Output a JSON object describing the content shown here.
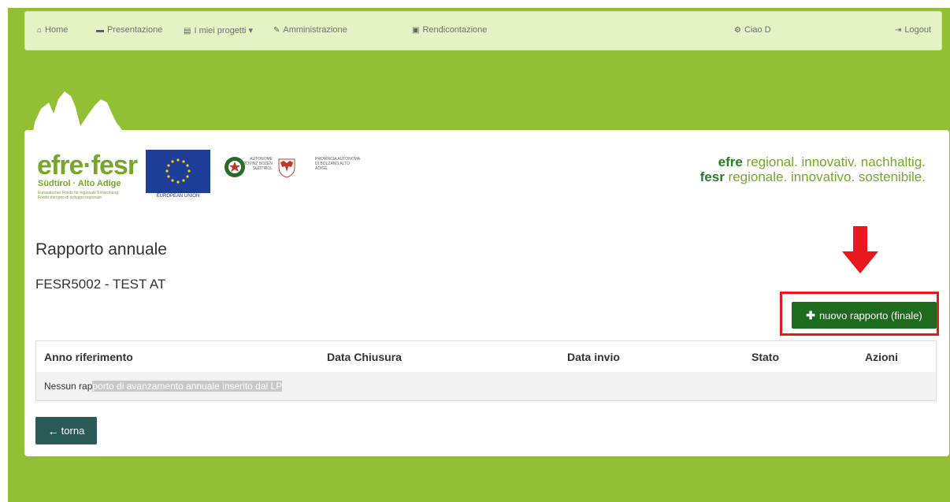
{
  "nav": {
    "home": "Home",
    "presentazione": "Presentazione",
    "progetti": "I miei progetti",
    "amministrazione": "Amministrazione",
    "rendicontazione": "Rendicontazione",
    "greeting": "Ciao D",
    "logout": "Logout"
  },
  "logos": {
    "efre": "efre·fesr",
    "efre_sub": "Südtirol · Alto Adige",
    "efre_tiny1": "Europäischer Fonds für regionale Entwicklung",
    "efre_tiny2": "Fondo europeo di sviluppo regionale",
    "eu": "EUROPEAN UNION",
    "prov_de": "AUTONOME PROVINZ BOZEN SÜDTIROL",
    "prov_it": "PROVINCIA AUTONOMA DI BOLZANO ALTO ADIGE"
  },
  "slogan": {
    "line1_brand": "efre",
    "line1_rest": " regional. innovativ. nachhaltig.",
    "line2_brand": "fesr",
    "line2_rest": " regionale. innovativo. sostenibile."
  },
  "page": {
    "title": "Rapporto annuale",
    "subtitle": "FESR5002 - TEST AT",
    "new_button": "nuovo rapporto (finale)",
    "back_button": "torna"
  },
  "table": {
    "headers": [
      "Anno riferimento",
      "Data Chiusura",
      "Data invio",
      "Stato",
      "Azioni"
    ],
    "empty_a": "Nessun rap",
    "empty_b": "porto di avanzamento annuale inserito dal LP"
  },
  "colors": {
    "background": "#92bf33",
    "navbar": "#e4f2c4",
    "primary_button": "#1e6b1e",
    "back_button": "#2a5a55",
    "highlight": "#e8181e"
  }
}
